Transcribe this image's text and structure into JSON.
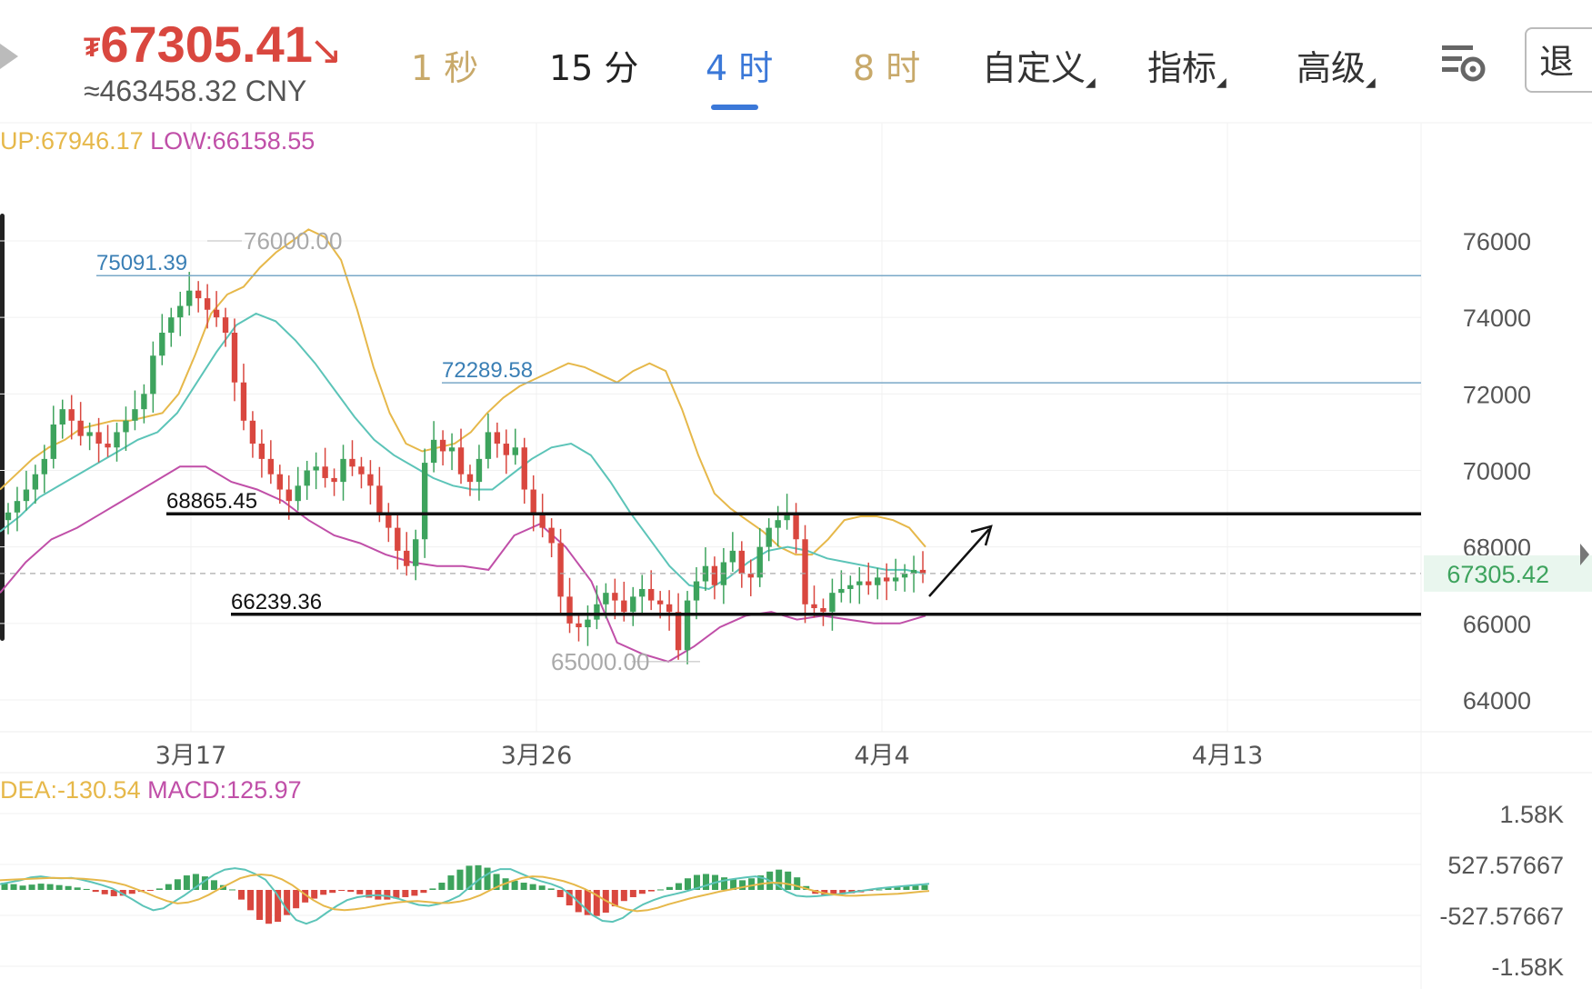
{
  "header": {
    "price": "67305.41",
    "price_cny": "≈463458.32 CNY",
    "tabs": [
      {
        "label": "1 秒",
        "color": "#c8a96a"
      },
      {
        "label": "15 分",
        "color": "#222222"
      },
      {
        "label": "4 时",
        "color": "#3b78d8",
        "active": true
      },
      {
        "label": "8 时",
        "color": "#c8a96a"
      }
    ],
    "menus": [
      "自定义",
      "指标",
      "高级"
    ],
    "exit_label": "退出"
  },
  "boll_legend": {
    "up": "UP:67946.17",
    "low": "LOW:66158.55"
  },
  "macd_legend": {
    "dea": "DEA:-130.54",
    "macd": "MACD:125.97"
  },
  "colors": {
    "up_candle": "#3da35d",
    "down_candle": "#d9473f",
    "boll_up": "#e6b84a",
    "boll_mid": "#5cc4b8",
    "boll_low": "#c04fa8",
    "hline": "#7aa8c8",
    "accent": "#3b78d8"
  },
  "chart_data": [
    {
      "type": "candlestick",
      "y_ticks": [
        "76000",
        "74000",
        "72000",
        "70000",
        "68000",
        "66000",
        "64000"
      ],
      "ylim": [
        63000,
        78000
      ],
      "x_ticks": [
        "3月17",
        "3月26",
        "4月4",
        "4月13"
      ],
      "last_price_label": "67305.42",
      "last_price": 67305.42,
      "annotations": {
        "high_label": "76000.00",
        "high": 76000,
        "low_label": "65000.00",
        "low": 65000,
        "hline1_label": "75091.39",
        "hline1": 75091.39,
        "hline2_label": "72289.58",
        "hline2": 72289.58,
        "support_label": "66239.36",
        "support": 66239.36,
        "resistance_label": "68865.45",
        "resistance": 68865.45
      },
      "close_series": [
        68900,
        69200,
        69500,
        69900,
        70300,
        71200,
        71600,
        71300,
        70900,
        71000,
        70700,
        70600,
        71000,
        71300,
        71600,
        72000,
        73000,
        73600,
        74000,
        74300,
        74700,
        74500,
        74200,
        74000,
        73600,
        72300,
        71300,
        70700,
        70300,
        69900,
        69500,
        69200,
        69600,
        70000,
        70100,
        69800,
        69700,
        70300,
        70100,
        69900,
        69600,
        68900,
        68500,
        67900,
        67500,
        68200,
        70200,
        70800,
        70500,
        70600,
        69900,
        69700,
        70300,
        71000,
        70700,
        70400,
        70600,
        69500,
        68900,
        68500,
        68100,
        66700,
        66000,
        65900,
        66100,
        66500,
        66800,
        66600,
        66300,
        66700,
        66900,
        66600,
        66500,
        66300,
        65300,
        66600,
        67100,
        67500,
        67000,
        67600,
        67900,
        67300,
        67200,
        68000,
        68500,
        68700,
        68900,
        68200,
        66500,
        66400,
        66300,
        66800,
        66900,
        67000,
        67100,
        67000,
        67200,
        67100,
        67200,
        67300,
        67400,
        67305
      ],
      "boll_up_series": [
        69500,
        69900,
        70300,
        70600,
        70800,
        71100,
        71200,
        71300,
        71300,
        71400,
        71500,
        72000,
        73000,
        74100,
        74600,
        74800,
        75300,
        75700,
        76000,
        76300,
        76100,
        75500,
        74200,
        72700,
        71500,
        70700,
        70500,
        70600,
        70700,
        71000,
        71500,
        71900,
        72200,
        72400,
        72600,
        72800,
        72700,
        72500,
        72300,
        72600,
        72800,
        72600,
        71600,
        70400,
        69400,
        69000,
        68700,
        68400,
        68000,
        67800,
        67800,
        68200,
        68700,
        68800,
        68800,
        68700,
        68500,
        68000
      ],
      "boll_mid_series": [
        68400,
        68800,
        69300,
        69600,
        69900,
        70200,
        70500,
        70800,
        71000,
        71500,
        72300,
        73100,
        73800,
        74100,
        73900,
        73400,
        72800,
        72100,
        71400,
        70800,
        70400,
        70100,
        69800,
        69600,
        69500,
        69500,
        69900,
        70300,
        70600,
        70700,
        70400,
        69700,
        68900,
        68200,
        67500,
        67000,
        66900,
        67200,
        67600,
        67900,
        68000,
        67900,
        67700,
        67600,
        67500,
        67400,
        67400,
        67300
      ],
      "boll_low_series": [
        66800,
        67600,
        68200,
        68500,
        68900,
        69300,
        69700,
        70100,
        70100,
        69700,
        69500,
        69200,
        68700,
        68300,
        68100,
        67800,
        67600,
        67500,
        67500,
        67400,
        68300,
        68600,
        68000,
        67100,
        65500,
        65200,
        65000,
        65400,
        65900,
        66200,
        66300,
        66100,
        66200,
        66100,
        66000,
        66000,
        66200
      ],
      "candle_up_color": "#3da35d",
      "candle_down_color": "#d9473f"
    },
    {
      "type": "macd",
      "y_ticks": [
        "1.58K",
        "527.57667",
        "-527.57667",
        "-1.58K"
      ],
      "ylim": [
        -1580,
        1580
      ],
      "hist_series": [
        150,
        120,
        90,
        110,
        130,
        120,
        100,
        80,
        50,
        20,
        -40,
        -90,
        -130,
        -120,
        -80,
        -40,
        -10,
        30,
        120,
        220,
        300,
        330,
        280,
        200,
        100,
        10,
        -200,
        -420,
        -620,
        -700,
        -660,
        -520,
        -380,
        -260,
        -180,
        -100,
        -60,
        -20,
        -40,
        -90,
        -160,
        -200,
        -200,
        -180,
        -150,
        -120,
        -60,
        30,
        150,
        300,
        420,
        500,
        510,
        460,
        330,
        240,
        190,
        150,
        120,
        90,
        30,
        -150,
        -320,
        -460,
        -520,
        -540,
        -470,
        -340,
        -230,
        -150,
        -80,
        -30,
        10,
        60,
        140,
        240,
        310,
        330,
        310,
        260,
        220,
        200,
        240,
        300,
        380,
        420,
        380,
        260,
        80,
        -80,
        -110,
        -100,
        -90,
        -70,
        -50,
        -20,
        10,
        40,
        60,
        80,
        90,
        100
      ],
      "dif_series": [
        120,
        160,
        200,
        260,
        280,
        250,
        240,
        250,
        210,
        160,
        100,
        30,
        -80,
        -200,
        -330,
        -420,
        -380,
        -250,
        -120,
        30,
        180,
        320,
        420,
        450,
        420,
        330,
        210,
        -50,
        -380,
        -620,
        -700,
        -620,
        -470,
        -330,
        -210,
        -150,
        -120,
        -110,
        -130,
        -180,
        -250,
        -310,
        -330,
        -290,
        -220,
        -120,
        60,
        230,
        360,
        430,
        430,
        340,
        250,
        180,
        120,
        40,
        -120,
        -320,
        -520,
        -640,
        -660,
        -580,
        -420,
        -300,
        -210,
        -140,
        -90,
        -40,
        20,
        80,
        150,
        200,
        230,
        260,
        280,
        230,
        120,
        -30,
        -120,
        -140,
        -130,
        -110,
        -90,
        -60,
        -30,
        0,
        30,
        50,
        70,
        90,
        110,
        126
      ],
      "dea_series": [
        200,
        210,
        220,
        230,
        240,
        250,
        245,
        240,
        230,
        210,
        190,
        150,
        100,
        20,
        -60,
        -150,
        -230,
        -280,
        -260,
        -200,
        -100,
        20,
        130,
        240,
        300,
        320,
        300,
        220,
        100,
        -60,
        -210,
        -330,
        -400,
        -420,
        -400,
        -370,
        -330,
        -290,
        -260,
        -240,
        -230,
        -250,
        -270,
        -270,
        -240,
        -190,
        -110,
        0,
        100,
        180,
        250,
        280,
        270,
        230,
        180,
        110,
        20,
        -90,
        -220,
        -330,
        -400,
        -440,
        -420,
        -370,
        -300,
        -240,
        -180,
        -130,
        -80,
        -30,
        10,
        50,
        90,
        130,
        150,
        140,
        100,
        40,
        -20,
        -70,
        -100,
        -120,
        -120,
        -110,
        -100,
        -90,
        -80,
        -60,
        -40,
        -20,
        -131
      ]
    }
  ]
}
